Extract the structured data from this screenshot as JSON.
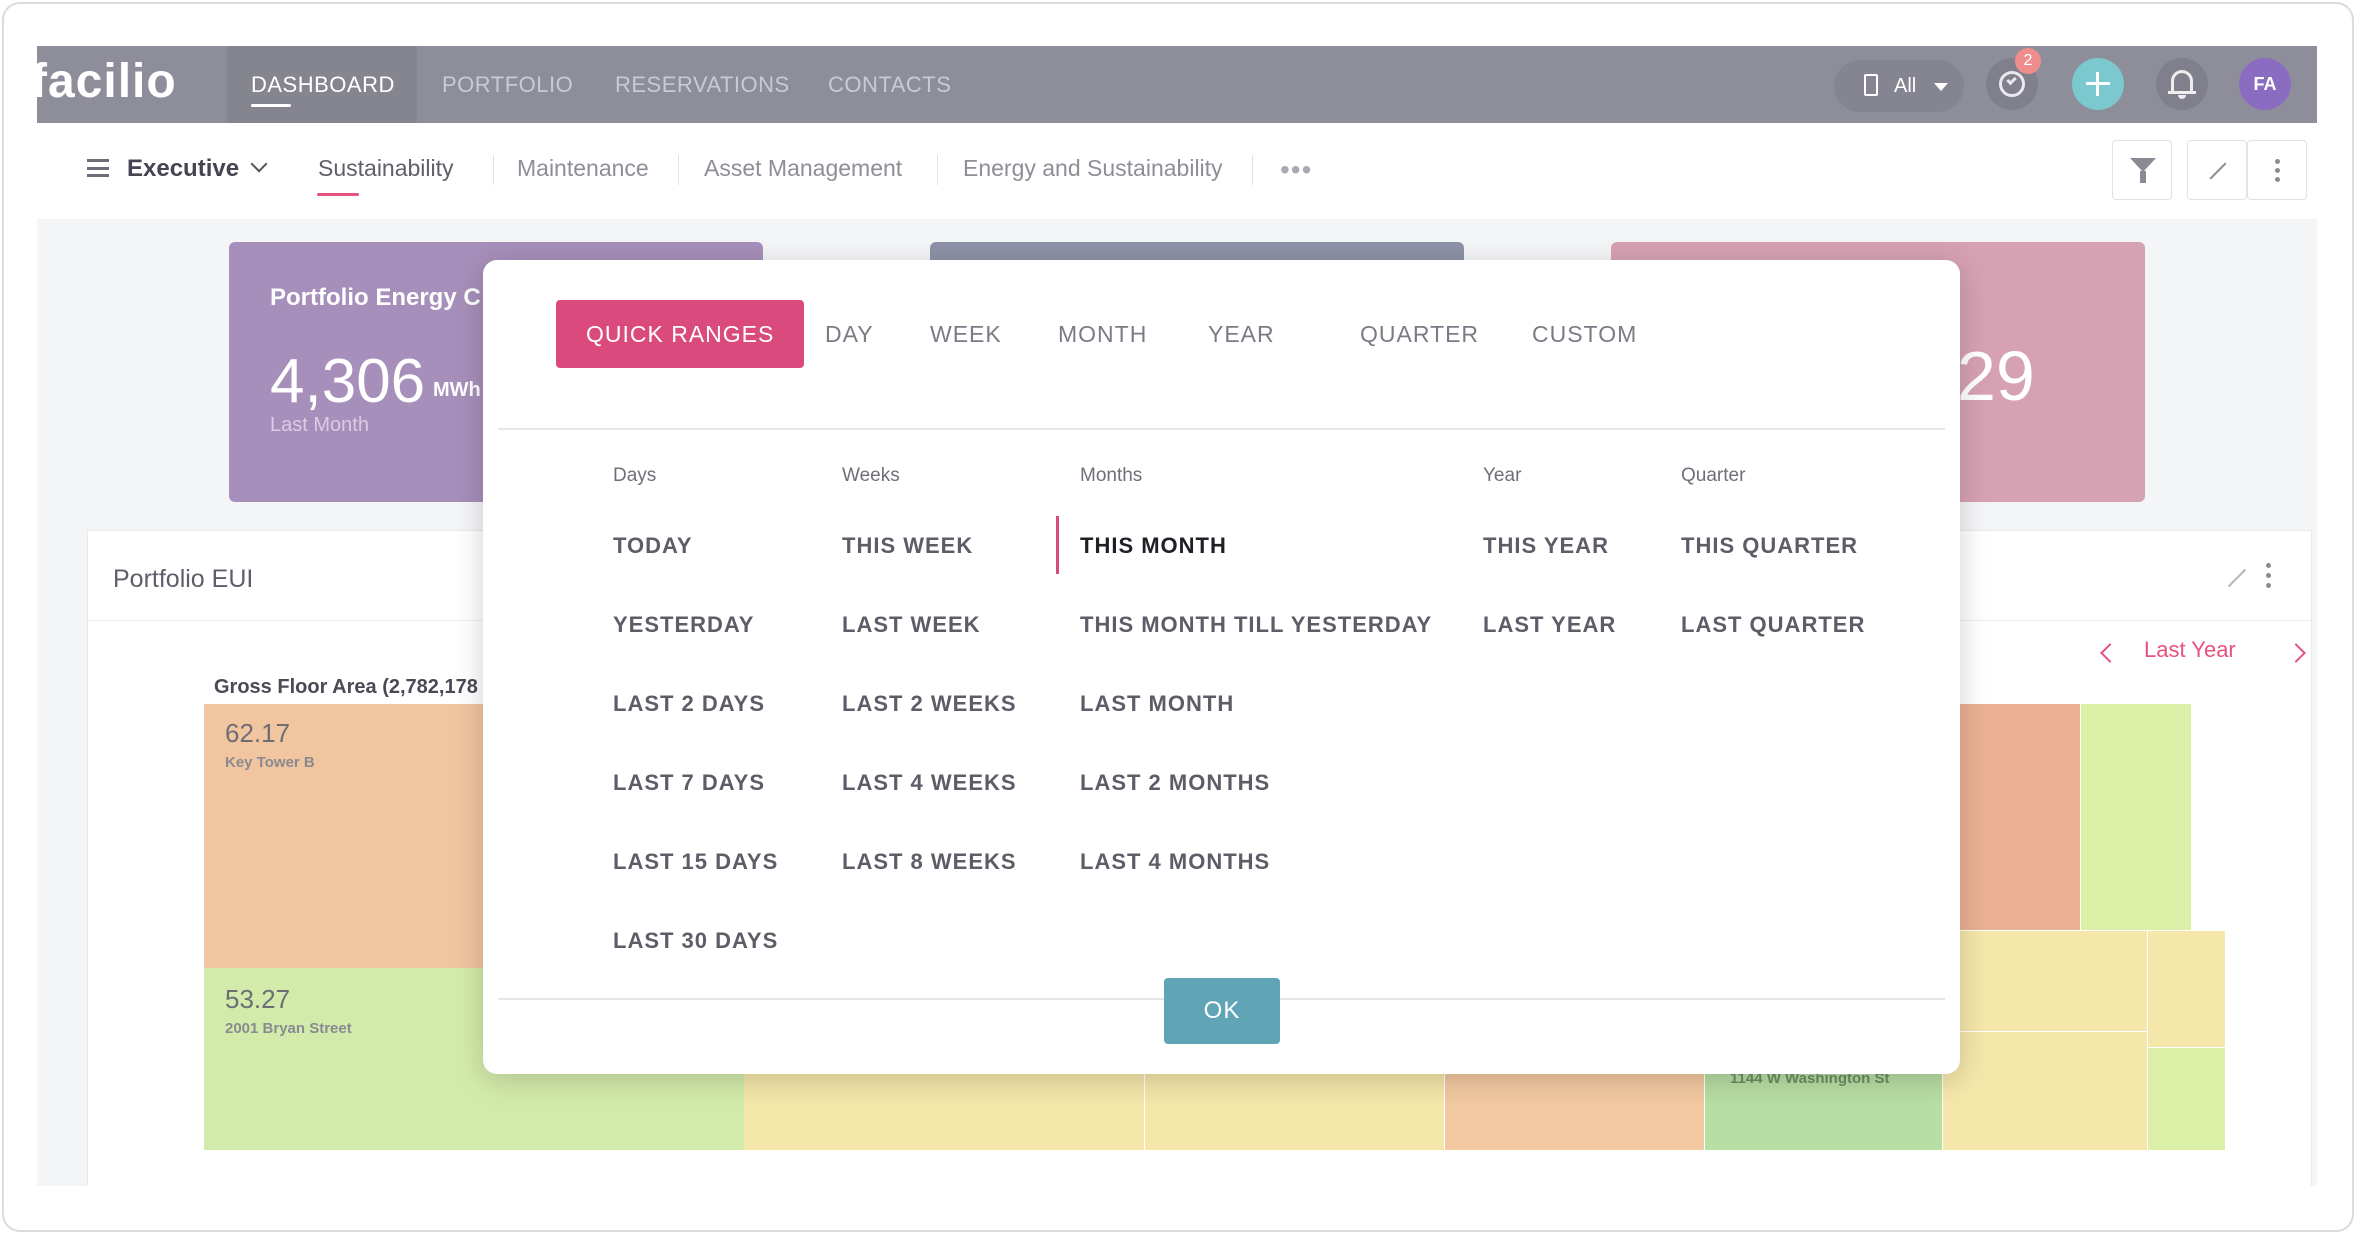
{
  "app": {
    "logo": "facilio",
    "nav_tabs": [
      "DASHBOARD",
      "PORTFOLIO",
      "RESERVATIONS",
      "CONTACTS"
    ],
    "site_filter": "All",
    "alarm_badge": "2",
    "avatar_initials": "FA"
  },
  "subheader": {
    "folder": "Executive",
    "tabs": [
      "Sustainability",
      "Maintenance",
      "Asset Management",
      "Energy and Sustainability"
    ],
    "more": "•••"
  },
  "cards": [
    {
      "title": "Portfolio Energy C",
      "value": "4,306",
      "unit": "MWh",
      "subtitle": "Last Month"
    },
    {
      "value": "29"
    }
  ],
  "panel": {
    "title": "Portfolio EUI",
    "range_label": "Last Year",
    "gross_floor_area": "Gross Floor Area (2,782,178",
    "treemap": [
      {
        "value": "62.17",
        "name": "Key Tower B"
      },
      {
        "value": "53.27",
        "name": "2001 Bryan Street"
      },
      {
        "value": "",
        "name": "1144 W Washington St"
      }
    ]
  },
  "modal": {
    "tabs": [
      "QUICK RANGES",
      "DAY",
      "WEEK",
      "MONTH",
      "YEAR",
      "QUARTER",
      "CUSTOM"
    ],
    "columns": {
      "days": {
        "heading": "Days",
        "items": [
          "TODAY",
          "YESTERDAY",
          "LAST 2 DAYS",
          "LAST 7 DAYS",
          "LAST 15 DAYS",
          "LAST 30 DAYS"
        ]
      },
      "weeks": {
        "heading": "Weeks",
        "items": [
          "THIS WEEK",
          "LAST WEEK",
          "LAST 2 WEEKS",
          "LAST 4 WEEKS",
          "LAST 8 WEEKS"
        ]
      },
      "months": {
        "heading": "Months",
        "items": [
          "THIS MONTH",
          "THIS MONTH TILL YESTERDAY",
          "LAST MONTH",
          "LAST 2 MONTHS",
          "LAST 4 MONTHS"
        ]
      },
      "year": {
        "heading": "Year",
        "items": [
          "THIS YEAR",
          "LAST YEAR"
        ]
      },
      "quarter": {
        "heading": "Quarter",
        "items": [
          "THIS QUARTER",
          "LAST QUARTER"
        ]
      }
    },
    "selected": "THIS MONTH",
    "ok_label": "OK",
    "accent_color": "#da4a7c",
    "ok_color": "#5fa5b5"
  }
}
